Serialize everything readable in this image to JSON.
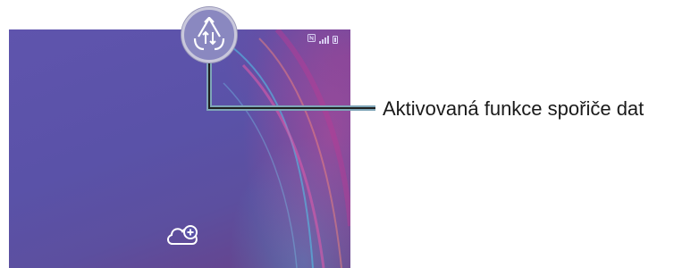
{
  "callout": {
    "label": "Aktivovaná funkce spořiče dat",
    "icon": "data-saver-icon"
  },
  "phone_screen": {
    "status_icons": [
      "nfc-icon",
      "signal-bars-icon",
      "battery-icon"
    ],
    "add_cloud_icon": "cloud-add-icon"
  },
  "colors": {
    "wallpaper": "#5f54ad",
    "badge_fill": "#8a88c0",
    "callout_line": "#7fa6b8"
  }
}
